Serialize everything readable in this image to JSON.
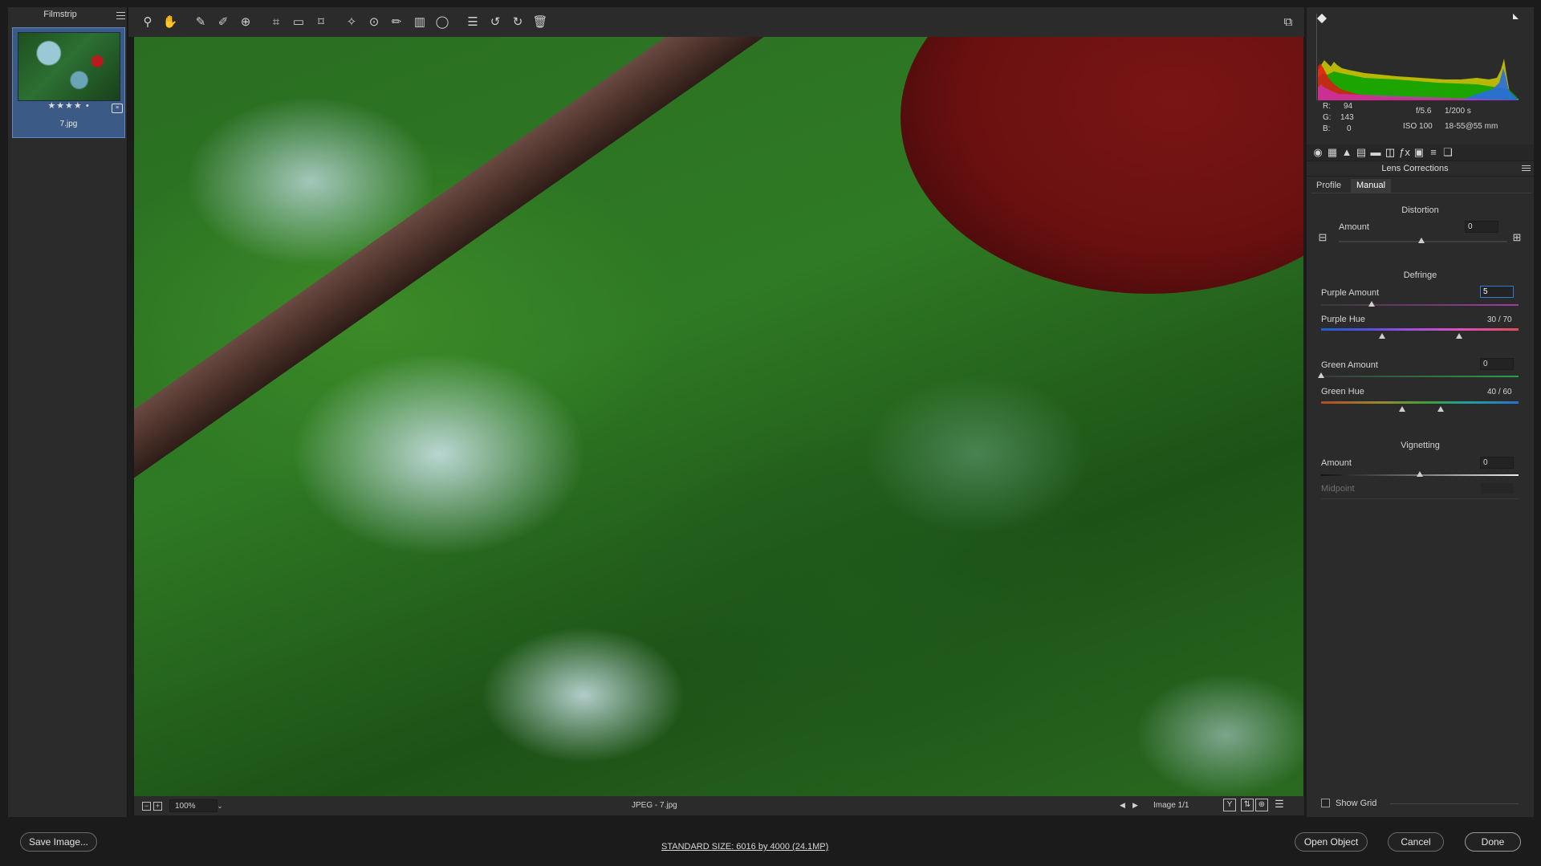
{
  "filmstrip": {
    "title": "Filmstrip",
    "menu_icon": "menu-icon",
    "thumbnail": {
      "rating": "★★★★ •",
      "filename": "7.jpg"
    }
  },
  "toolbar": {
    "tools": [
      "zoom-icon",
      "hand-icon",
      "white-balance-icon",
      "color-sampler-icon",
      "targeted-adjustment-icon",
      "crop-icon",
      "straighten-icon",
      "transform-icon",
      "spot-removal-icon",
      "red-eye-icon",
      "adjustment-brush-icon",
      "graduated-filter-icon",
      "radial-filter-icon",
      "presets-list-icon",
      "rotate-left-icon",
      "rotate-right-icon",
      "trash-icon"
    ],
    "active_tool": "hand-icon"
  },
  "status": {
    "zoom": "100%",
    "file": "JPEG  -  7.jpg",
    "image_count": "Image 1/1"
  },
  "histogram": {
    "r_label": "R:",
    "r": "94",
    "g_label": "G:",
    "g": "143",
    "b_label": "B:",
    "b": "0",
    "aperture": "f/5.6",
    "shutter": "1/200 s",
    "iso": "ISO 100",
    "lens": "18-55@55 mm"
  },
  "panel": {
    "title": "Lens Corrections",
    "tabs": [
      "Profile",
      "Manual"
    ],
    "selected_tab": "Manual",
    "distortion": {
      "section": "Distortion",
      "label": "Amount",
      "value": "0"
    },
    "defringe": {
      "section": "Defringe",
      "purple_amount_label": "Purple Amount",
      "purple_amount": "5",
      "purple_hue_label": "Purple Hue",
      "purple_hue": "30 / 70",
      "green_amount_label": "Green Amount",
      "green_amount": "0",
      "green_hue_label": "Green Hue",
      "green_hue": "40 / 60"
    },
    "vignetting": {
      "section": "Vignetting",
      "amount_label": "Amount",
      "amount": "0",
      "midpoint_label": "Midpoint",
      "midpoint": ""
    },
    "show_grid_label": "Show Grid"
  },
  "footer": {
    "save_label": "Save Image...",
    "standard_size": "STANDARD SIZE: 6016 by 4000 (24.1MP)",
    "open_label": "Open Object",
    "cancel_label": "Cancel",
    "done_label": "Done"
  },
  "colors": {
    "accent": "#2e7bd6",
    "panel_bg": "#2b2b2b",
    "app_bg": "#1b1b1b"
  }
}
